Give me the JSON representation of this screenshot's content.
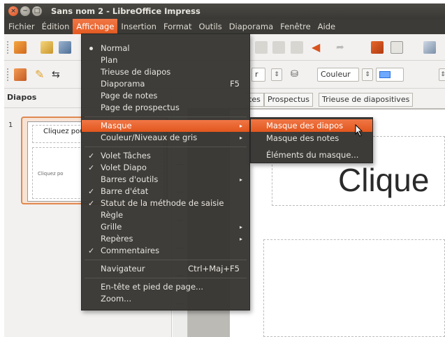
{
  "window": {
    "title": "Sans nom 2 - LibreOffice Impress"
  },
  "menubar": {
    "items": [
      "Fichier",
      "Édition",
      "Affichage",
      "Insertion",
      "Format",
      "Outils",
      "Diaporama",
      "Fenêtre",
      "Aide"
    ],
    "active": "Affichage"
  },
  "toolbar": {
    "combo_color": "Couleur",
    "combo_partial": "r"
  },
  "panel": {
    "title": "Diapos",
    "slide_number": "1",
    "thumb_title": "Cliquez pou",
    "thumb_text": "Cliquez po"
  },
  "tabs": {
    "partial": "tes",
    "prospectus": "Prospectus",
    "trieuse": "Trieuse de diapositives"
  },
  "canvas": {
    "big_text": "Clique"
  },
  "view_menu": {
    "normal": "Normal",
    "plan": "Plan",
    "trieuse": "Trieuse de diapos",
    "diaporama": "Diaporama",
    "diaporama_shortcut": "F5",
    "notes": "Page de notes",
    "prospectus": "Page de prospectus",
    "masque": "Masque",
    "couleur": "Couleur/Niveaux de gris",
    "volet_taches": "Volet Tâches",
    "volet_diapo": "Volet Diapo",
    "barres": "Barres d'outils",
    "barre_etat": "Barre d'état",
    "statut": "Statut de la méthode de saisie",
    "regle": "Règle",
    "grille": "Grille",
    "reperes": "Repères",
    "commentaires": "Commentaires",
    "navigateur": "Navigateur",
    "navigateur_shortcut": "Ctrl+Maj+F5",
    "entete": "En-tête et pied de page...",
    "zoom": "Zoom..."
  },
  "masque_submenu": {
    "diapos": "Masque des diapos",
    "notes": "Masque des notes",
    "elements": "Éléments du masque..."
  },
  "colors": {
    "accent": "#e8622a",
    "menubar": "#3c3b37",
    "menu_bg": "#363532"
  }
}
